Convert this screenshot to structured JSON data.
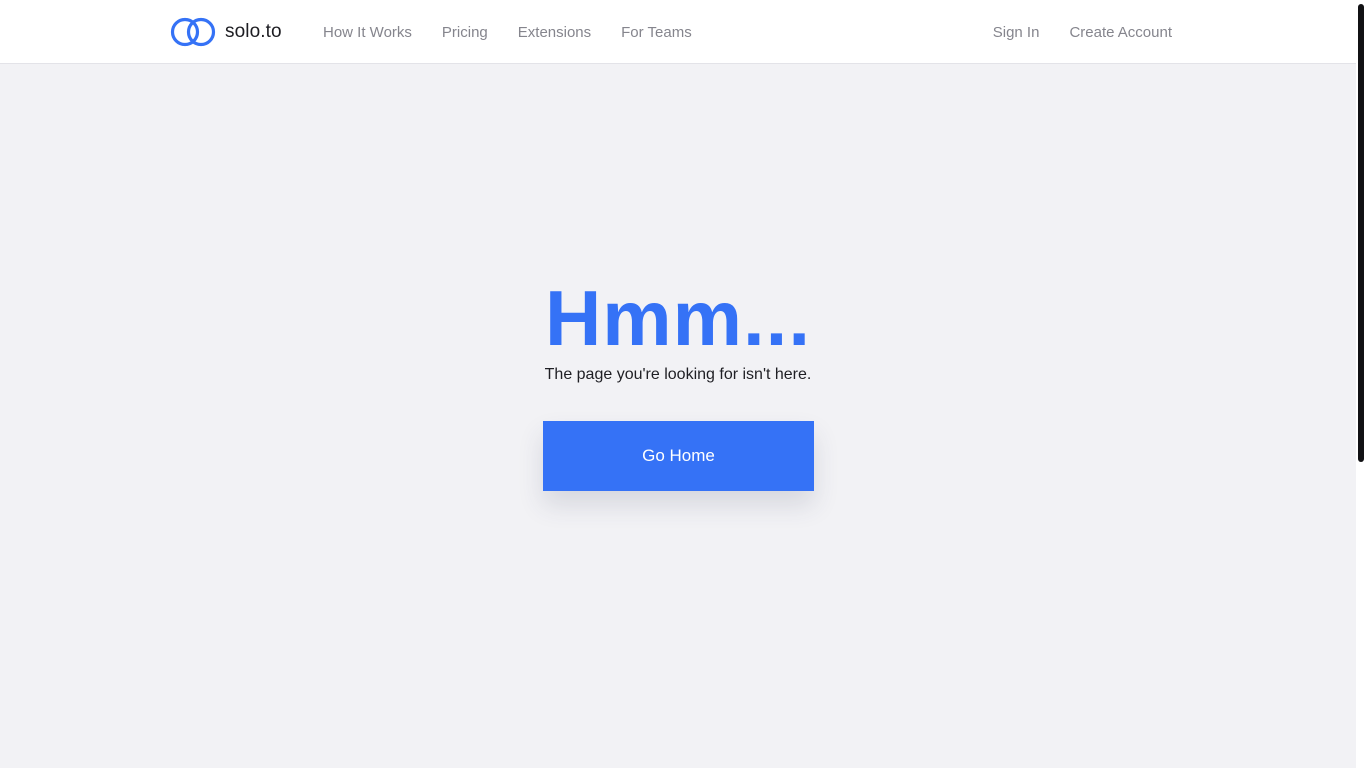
{
  "brand": {
    "name": "solo.to",
    "icon": "linked-rings-logo-icon",
    "color": "#3572f6"
  },
  "nav": {
    "left": [
      {
        "label": "How It Works"
      },
      {
        "label": "Pricing"
      },
      {
        "label": "Extensions"
      },
      {
        "label": "For Teams"
      }
    ],
    "right": [
      {
        "label": "Sign In"
      },
      {
        "label": "Create Account"
      }
    ]
  },
  "main": {
    "heading": "Hmm...",
    "message": "The page you're looking for isn't here.",
    "button_label": "Go Home"
  },
  "colors": {
    "accent": "#3572f6",
    "background": "#f2f2f5",
    "nav_text": "#85858d",
    "body_text": "#1f1f24"
  }
}
